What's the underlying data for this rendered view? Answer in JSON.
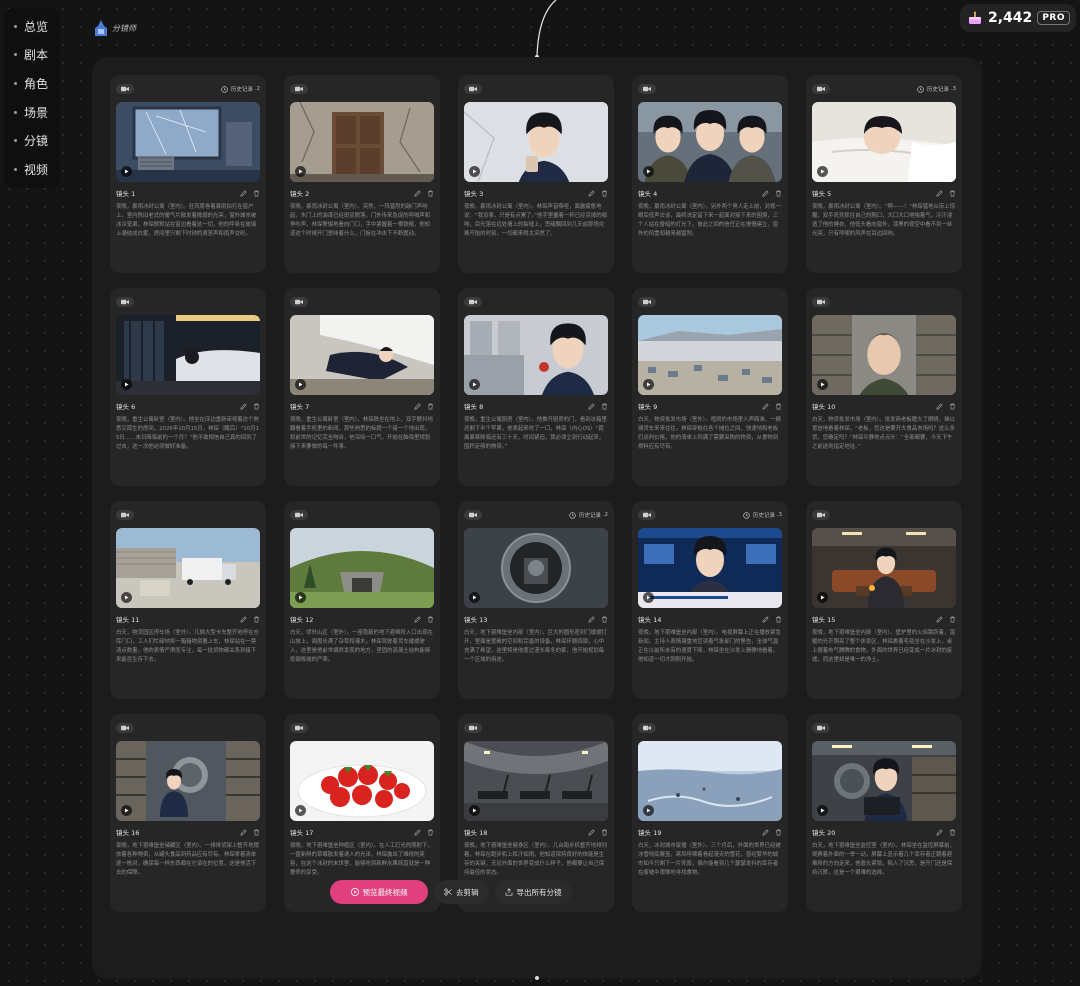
{
  "nav": [
    "总览",
    "剧本",
    "角色",
    "场景",
    "分镜",
    "视频"
  ],
  "brand": {
    "label": "分镜师"
  },
  "credits": {
    "value": "2,442",
    "badge": "PRO"
  },
  "history_label": "历史记录 · ",
  "shots": [
    {
      "label": "镜头 1",
      "history": "2",
      "scene": "storm",
      "desc": "夜晚，暴雨冰封公寓（室内）。狂风席卷着暴雨拍打在窗户上，室内陈旧老式的暖气片散发着微弱的光亮，窗外城市被冰冷笼罩，林琛默默站在窗边看着这一切，他的呼吸在玻璃上凝结成白雾，房间里只剩下时钟的滴答声和雨声交织。"
    },
    {
      "label": "镜头 2",
      "history": "",
      "scene": "door",
      "desc": "夜晚，暴雨冰封公寓（室内）。突然，一阵猛烈的敲门声响起，木门上的油漆已经斑驳脱落，门外传来急促的呼喊声和争吵声，林琛警惕地看向门口，手中紧握着一根铁棍，他知道这个时候开门意味着什么，门板在冲击下不断震动。"
    },
    {
      "label": "镜头 3",
      "history": "",
      "scene": "man-cup",
      "desc": "夜晚，暴雨冰封公寓（室内）。林琛声音嘶哑，面露疲惫地说：“我没事，只是有点累了。”他手里握着一杯已经凉掉的咖啡，目光落在远处墙上的裂缝上，思绪飘回到几天前那场灾难开始的时刻，一切都来得太突然了。"
    },
    {
      "label": "镜头 4",
      "history": "",
      "scene": "group",
      "desc": "夜晚，暴雨冰封公寓（室内）。另外两个男人走上前，对视一眼后低声交谈，最终决定留下来一起面对接下来的困境，三个人站在昏暗的灯光下，彼此之间的信任正在慢慢建立，窗外的风雪却越来越猛烈。"
    },
    {
      "label": "镜头 5",
      "history": "3",
      "scene": "sleep",
      "desc": "夜晚，暴雨冰封公寓（室内）。“啊——！”林琛猛地从床上惊醒，双手死死抓住自己的胸口，大口大口地喘着气，冷汗浸透了他的睡衣，他低头看向窗外，漆黑的夜空中看不到一丝光亮，只有呼啸的风声在耳边回响。"
    },
    {
      "label": "镜头 6",
      "history": "",
      "scene": "bed",
      "desc": "夜晚，重生公寓卧室（室内）。他坐在床边重新审视着这个熟悉又陌生的房间，2026年10月15日，林琛（醒后）“10月15日……末日降临前的一个月？”他不敢相信自己真的回到了过去，这一次他必须做好准备。"
    },
    {
      "label": "镜头 7",
      "history": "",
      "scene": "floor",
      "desc": "夜晚，重生公寓卧室（室内）。林琛跌坐在地上，双手颤抖地翻看着手机里的新闻，那些熟悉的标题一个接一个地出现，和前世的记忆完全吻合，他深吸一口气，开始在脑海里规划接下来要做的每一件事。"
    },
    {
      "label": "镜头 8",
      "history": "",
      "scene": "apple",
      "desc": "夜晚，重生公寓厨房（室内）。他推开厨房的门，看到冰箱里还剩下半个苹果，他拿起来咬了一口，林琛（内心OS）“距离暴寒降临还有三十天，时间紧迫，我必须立刻行动起来，囤积足够的物资。”"
    },
    {
      "label": "镜头 9",
      "history": "",
      "scene": "market",
      "desc": "白天，物资批发市场（室外）。喧闹的市场里人声鼎沸，一辆辆货车来来往往，林琛穿梭在各个摊位之间，快速地和老板们谈判价格，他的清单上列满了需要采购的物资，从食物到燃料应有尽有。"
    },
    {
      "label": "镜头 10",
      "history": "",
      "scene": "warehouse-man",
      "desc": "白天，物资批发市场（室内）。批发商老板瞪大了眼睛，难以置信地看着林琛，“老板，您这是要开大食品市场吗？这么多货，您确定吗？”林琛平静地点点头：“全部都要，今天下午之前送到指定地址。”"
    },
    {
      "label": "镜头 11",
      "history": "",
      "scene": "trucks",
      "desc": "白天，物流园区停车场（室外）。几辆大型卡车整齐地停在仓库门口，工人们忙碌地将一箱箱物资搬上车，林琛站在一旁清点数量，他的表情严肃而专注，每一批货物都关系到接下来能否生存下去。"
    },
    {
      "label": "镜头 12",
      "history": "",
      "scene": "bunker-hill",
      "desc": "白天，郊外山区（室外）。一座隐蔽的地下避难所入口出现在山坡上，周围长满了杂草和灌木，林琛驾驶着货车缓缓驶入，这里是他前世偶然发现的地方，坚固的混凝土结构能够抵御极端的严寒。"
    },
    {
      "label": "镜头 13",
      "history": "2",
      "scene": "vault",
      "desc": "白天，地下避难堡垒内部（室内）。巨大的圆形密封门缓缓打开，里面是宽敞的空间和完善的设备，林琛环顾四周，心中充满了希望，这里将是他度过漫长寒冬的家，他开始规划每一个区域的用途。"
    },
    {
      "label": "镜头 14",
      "history": "3",
      "scene": "news",
      "desc": "夜晚，地下避难堡垒内部（室内）。电视屏幕上正在播放紧急新闻，主持人表情凝重地宣读着气象部门的警告，全球气温正在以前所未有的速度下降，林琛坐在沙发上静静地看着，他知道一切才刚刚开始。"
    },
    {
      "label": "镜头 15",
      "history": "",
      "scene": "lounge",
      "desc": "夜晚，地下避难堡垒内部（室内）。壁炉里的火焰跳跃着，温暖的光芒照亮了整个休息区，林琛裹着毛毯坐在沙发上，桌上摆着热气腾腾的食物，外面的世界已经变成一片冰封的废墟，而这里却是唯一的净土。"
    },
    {
      "label": "镜头 16",
      "history": "",
      "scene": "storage",
      "desc": "夜晚，地下避难堡垒储藏区（室内）。一排排货架上整齐地摆放着各种物资，从罐头食品到药品应有尽有，林琛拿着清单逐一核对，确保每一样东西都在它该在的位置，这是他活下去的保障。"
    },
    {
      "label": "镜头 17",
      "history": "",
      "scene": "strawberry",
      "desc": "夜晚，地下避难堡垒种植区（室内）。在人工灯光的照射下，一盘新鲜的草莓散发着诱人的光泽，林琛露出了难得的笑容，在这个冰封的末世里，能够吃到新鲜水果简直就是一种奢侈的享受。"
    },
    {
      "label": "镜头 18",
      "history": "",
      "scene": "gym",
      "desc": "夜晚，地下避难堡垒健身区（室内）。几台跑步机整齐地排列着，林琛在跑步机上挥汗如雨，他知道保持良好的体能是生存的关键，无论外面的世界变成什么样子，他都要让自己保持最佳的状态。"
    },
    {
      "label": "镜头 19",
      "history": "",
      "scene": "ice",
      "desc": "白天，冰封城市废墟（室外）。三个月后，外面的世界已经被冰雪彻底覆盖，寒风呼啸着卷起漫天的雪花，曾经繁华的城市如今只剩下一片死寂，偶尔能看到几个瑟瑟发抖的幸存者在废墟中艰难地寻找食物。"
    },
    {
      "label": "镜头 20",
      "history": "",
      "scene": "monitor",
      "desc": "白天，地下避难堡垒监控室（室内）。林琛坐在监控屏幕前，观察着外面的一举一动，屏幕上显示着几个幸存者正朝着避难所的方向走来，他眉头紧锁，陷入了沉思，是开门还是保持沉默，这是一个艰难的选择。"
    }
  ],
  "actions": {
    "preview": "预览最终视频",
    "edit": "去剪辑",
    "export": "导出所有分镜"
  },
  "colors": {
    "accent": "#e0407e",
    "panel": "#1c1c1c",
    "card": "#262626"
  }
}
